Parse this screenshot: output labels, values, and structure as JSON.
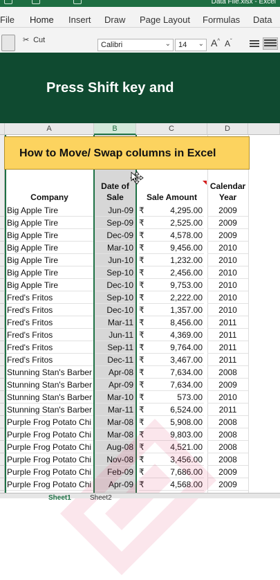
{
  "window": {
    "title": "Data File.xlsx - Excel"
  },
  "ribbon": {
    "tabs": [
      "File",
      "Home",
      "Insert",
      "Draw",
      "Page Layout",
      "Formulas",
      "Data"
    ],
    "active_tab": "Home",
    "cut_label": "Cut",
    "font_name": "Calibri",
    "font_size": "14"
  },
  "banner": {
    "text": "Press Shift key and"
  },
  "overlay": {
    "title": "How to Move/ Swap columns in Excel"
  },
  "grid": {
    "columns": [
      "A",
      "B",
      "C",
      "D"
    ],
    "selected_column": "B",
    "headers": {
      "company": "Company",
      "date_line1": "Date of",
      "date_line2": "Sale",
      "amount": "Sale Amount",
      "year_line1": "Calendar",
      "year_line2": "Year"
    },
    "currency_symbol": "₹",
    "rows": [
      {
        "company": "Big Apple Tire",
        "date": "Jun-09",
        "amount": "4,295.00",
        "year": "2009"
      },
      {
        "company": "Big Apple Tire",
        "date": "Sep-09",
        "amount": "2,525.00",
        "year": "2009"
      },
      {
        "company": "Big Apple Tire",
        "date": "Dec-09",
        "amount": "4,578.00",
        "year": "2009"
      },
      {
        "company": "Big Apple Tire",
        "date": "Mar-10",
        "amount": "9,456.00",
        "year": "2010"
      },
      {
        "company": "Big Apple Tire",
        "date": "Jun-10",
        "amount": "1,232.00",
        "year": "2010"
      },
      {
        "company": "Big Apple Tire",
        "date": "Sep-10",
        "amount": "2,456.00",
        "year": "2010"
      },
      {
        "company": "Big Apple Tire",
        "date": "Dec-10",
        "amount": "9,753.00",
        "year": "2010"
      },
      {
        "company": "Fred's Fritos",
        "date": "Sep-10",
        "amount": "2,222.00",
        "year": "2010"
      },
      {
        "company": "Fred's Fritos",
        "date": "Dec-10",
        "amount": "1,357.00",
        "year": "2010"
      },
      {
        "company": "Fred's Fritos",
        "date": "Mar-11",
        "amount": "8,456.00",
        "year": "2011"
      },
      {
        "company": "Fred's Fritos",
        "date": "Jun-11",
        "amount": "4,369.00",
        "year": "2011"
      },
      {
        "company": "Fred's Fritos",
        "date": "Sep-11",
        "amount": "9,764.00",
        "year": "2011"
      },
      {
        "company": "Fred's Fritos",
        "date": "Dec-11",
        "amount": "3,467.00",
        "year": "2011"
      },
      {
        "company": "Stunning Stan's Barber",
        "date": "Apr-08",
        "amount": "7,634.00",
        "year": "2008"
      },
      {
        "company": "Stunning Stan's Barber",
        "date": "Apr-09",
        "amount": "7,634.00",
        "year": "2009"
      },
      {
        "company": "Stunning Stan's Barber",
        "date": "Mar-10",
        "amount": "573.00",
        "year": "2010"
      },
      {
        "company": "Stunning Stan's Barber",
        "date": "Mar-11",
        "amount": "6,524.00",
        "year": "2011"
      },
      {
        "company": "Purple Frog Potato Chi",
        "date": "Mar-08",
        "amount": "5,908.00",
        "year": "2008"
      },
      {
        "company": "Purple Frog Potato Chi",
        "date": "Mar-08",
        "amount": "9,803.00",
        "year": "2008"
      },
      {
        "company": "Purple Frog Potato Chi",
        "date": "Aug-08",
        "amount": "4,521.00",
        "year": "2008"
      },
      {
        "company": "Purple Frog Potato Chi",
        "date": "Nov-08",
        "amount": "3,456.00",
        "year": "2008"
      },
      {
        "company": "Purple Frog Potato Chi",
        "date": "Feb-09",
        "amount": "7,686.00",
        "year": "2009"
      },
      {
        "company": "Purple Frog Potato Chi",
        "date": "Apr-09",
        "amount": "4,568.00",
        "year": "2009"
      }
    ]
  },
  "sheets": [
    "Sheet1",
    "Sheet2"
  ],
  "colors": {
    "excel_green": "#1e7145",
    "banner": "#0f4a30",
    "overlay_yellow": "#fcd35f"
  }
}
